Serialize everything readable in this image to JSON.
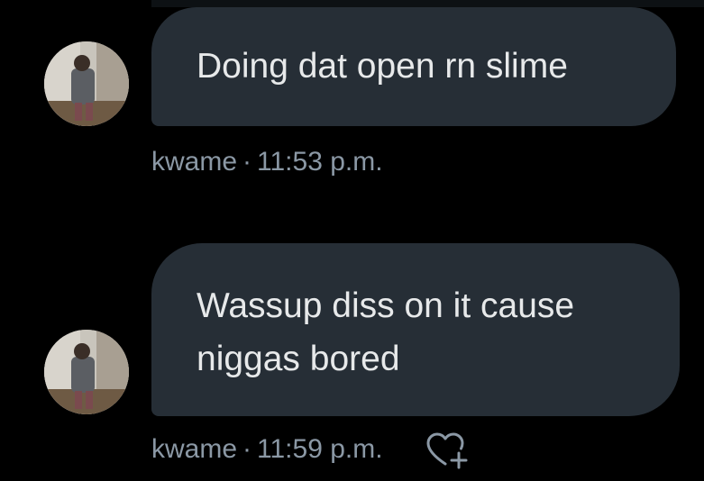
{
  "messages": [
    {
      "text": "Doing dat open rn slime",
      "sender": "kwame",
      "separator": "·",
      "time": "11:53 p.m."
    },
    {
      "text": "Wassup diss on it cause niggas bored",
      "sender": "kwame",
      "separator": "·",
      "time": "11:59 p.m."
    }
  ],
  "icons": {
    "react": "heart-plus-icon"
  },
  "colors": {
    "background": "#000000",
    "bubble": "#262e36",
    "bubble_text": "#e7e9ea",
    "meta_text": "#8b98a5"
  }
}
